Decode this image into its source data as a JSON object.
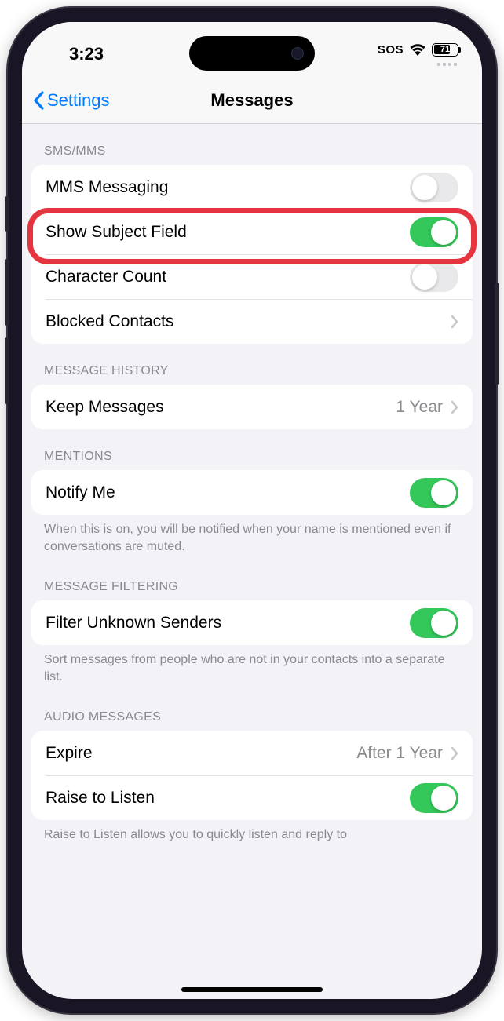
{
  "status": {
    "time": "3:23",
    "sos": "SOS",
    "battery_pct": "71"
  },
  "nav": {
    "back_label": "Settings",
    "title": "Messages"
  },
  "sections": {
    "sms": {
      "header": "SMS/MMS",
      "mms": "MMS Messaging",
      "subject": "Show Subject Field",
      "charcount": "Character Count",
      "blocked": "Blocked Contacts"
    },
    "history": {
      "header": "MESSAGE HISTORY",
      "keep": "Keep Messages",
      "keep_value": "1 Year"
    },
    "mentions": {
      "header": "MENTIONS",
      "notify": "Notify Me",
      "footer": "When this is on, you will be notified when your name is mentioned even if conversations are muted."
    },
    "filtering": {
      "header": "MESSAGE FILTERING",
      "filter": "Filter Unknown Senders",
      "footer": "Sort messages from people who are not in your contacts into a separate list."
    },
    "audio": {
      "header": "AUDIO MESSAGES",
      "expire": "Expire",
      "expire_value": "After 1 Year",
      "raise": "Raise to Listen",
      "footer": "Raise to Listen allows you to quickly listen and reply to"
    }
  }
}
